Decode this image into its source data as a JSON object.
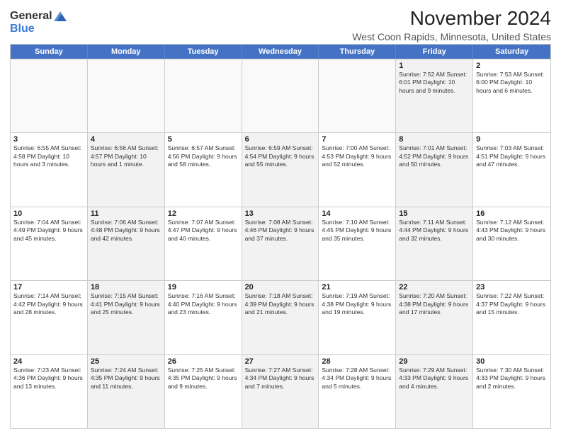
{
  "logo": {
    "general": "General",
    "blue": "Blue"
  },
  "header": {
    "month": "November 2024",
    "location": "West Coon Rapids, Minnesota, United States"
  },
  "weekdays": [
    "Sunday",
    "Monday",
    "Tuesday",
    "Wednesday",
    "Thursday",
    "Friday",
    "Saturday"
  ],
  "weeks": [
    [
      {
        "day": "",
        "info": ""
      },
      {
        "day": "",
        "info": ""
      },
      {
        "day": "",
        "info": ""
      },
      {
        "day": "",
        "info": ""
      },
      {
        "day": "",
        "info": ""
      },
      {
        "day": "1",
        "info": "Sunrise: 7:52 AM\nSunset: 6:01 PM\nDaylight: 10 hours and 9 minutes."
      },
      {
        "day": "2",
        "info": "Sunrise: 7:53 AM\nSunset: 6:00 PM\nDaylight: 10 hours and 6 minutes."
      }
    ],
    [
      {
        "day": "3",
        "info": "Sunrise: 6:55 AM\nSunset: 4:58 PM\nDaylight: 10 hours and 3 minutes."
      },
      {
        "day": "4",
        "info": "Sunrise: 6:56 AM\nSunset: 4:57 PM\nDaylight: 10 hours and 1 minute."
      },
      {
        "day": "5",
        "info": "Sunrise: 6:57 AM\nSunset: 4:56 PM\nDaylight: 9 hours and 58 minutes."
      },
      {
        "day": "6",
        "info": "Sunrise: 6:59 AM\nSunset: 4:54 PM\nDaylight: 9 hours and 55 minutes."
      },
      {
        "day": "7",
        "info": "Sunrise: 7:00 AM\nSunset: 4:53 PM\nDaylight: 9 hours and 52 minutes."
      },
      {
        "day": "8",
        "info": "Sunrise: 7:01 AM\nSunset: 4:52 PM\nDaylight: 9 hours and 50 minutes."
      },
      {
        "day": "9",
        "info": "Sunrise: 7:03 AM\nSunset: 4:51 PM\nDaylight: 9 hours and 47 minutes."
      }
    ],
    [
      {
        "day": "10",
        "info": "Sunrise: 7:04 AM\nSunset: 4:49 PM\nDaylight: 9 hours and 45 minutes."
      },
      {
        "day": "11",
        "info": "Sunrise: 7:06 AM\nSunset: 4:48 PM\nDaylight: 9 hours and 42 minutes."
      },
      {
        "day": "12",
        "info": "Sunrise: 7:07 AM\nSunset: 4:47 PM\nDaylight: 9 hours and 40 minutes."
      },
      {
        "day": "13",
        "info": "Sunrise: 7:08 AM\nSunset: 4:46 PM\nDaylight: 9 hours and 37 minutes."
      },
      {
        "day": "14",
        "info": "Sunrise: 7:10 AM\nSunset: 4:45 PM\nDaylight: 9 hours and 35 minutes."
      },
      {
        "day": "15",
        "info": "Sunrise: 7:11 AM\nSunset: 4:44 PM\nDaylight: 9 hours and 32 minutes."
      },
      {
        "day": "16",
        "info": "Sunrise: 7:12 AM\nSunset: 4:43 PM\nDaylight: 9 hours and 30 minutes."
      }
    ],
    [
      {
        "day": "17",
        "info": "Sunrise: 7:14 AM\nSunset: 4:42 PM\nDaylight: 9 hours and 28 minutes."
      },
      {
        "day": "18",
        "info": "Sunrise: 7:15 AM\nSunset: 4:41 PM\nDaylight: 9 hours and 25 minutes."
      },
      {
        "day": "19",
        "info": "Sunrise: 7:16 AM\nSunset: 4:40 PM\nDaylight: 9 hours and 23 minutes."
      },
      {
        "day": "20",
        "info": "Sunrise: 7:18 AM\nSunset: 4:39 PM\nDaylight: 9 hours and 21 minutes."
      },
      {
        "day": "21",
        "info": "Sunrise: 7:19 AM\nSunset: 4:38 PM\nDaylight: 9 hours and 19 minutes."
      },
      {
        "day": "22",
        "info": "Sunrise: 7:20 AM\nSunset: 4:38 PM\nDaylight: 9 hours and 17 minutes."
      },
      {
        "day": "23",
        "info": "Sunrise: 7:22 AM\nSunset: 4:37 PM\nDaylight: 9 hours and 15 minutes."
      }
    ],
    [
      {
        "day": "24",
        "info": "Sunrise: 7:23 AM\nSunset: 4:36 PM\nDaylight: 9 hours and 13 minutes."
      },
      {
        "day": "25",
        "info": "Sunrise: 7:24 AM\nSunset: 4:35 PM\nDaylight: 9 hours and 11 minutes."
      },
      {
        "day": "26",
        "info": "Sunrise: 7:25 AM\nSunset: 4:35 PM\nDaylight: 9 hours and 9 minutes."
      },
      {
        "day": "27",
        "info": "Sunrise: 7:27 AM\nSunset: 4:34 PM\nDaylight: 9 hours and 7 minutes."
      },
      {
        "day": "28",
        "info": "Sunrise: 7:28 AM\nSunset: 4:34 PM\nDaylight: 9 hours and 5 minutes."
      },
      {
        "day": "29",
        "info": "Sunrise: 7:29 AM\nSunset: 4:33 PM\nDaylight: 9 hours and 4 minutes."
      },
      {
        "day": "30",
        "info": "Sunrise: 7:30 AM\nSunset: 4:33 PM\nDaylight: 9 hours and 2 minutes."
      }
    ]
  ]
}
